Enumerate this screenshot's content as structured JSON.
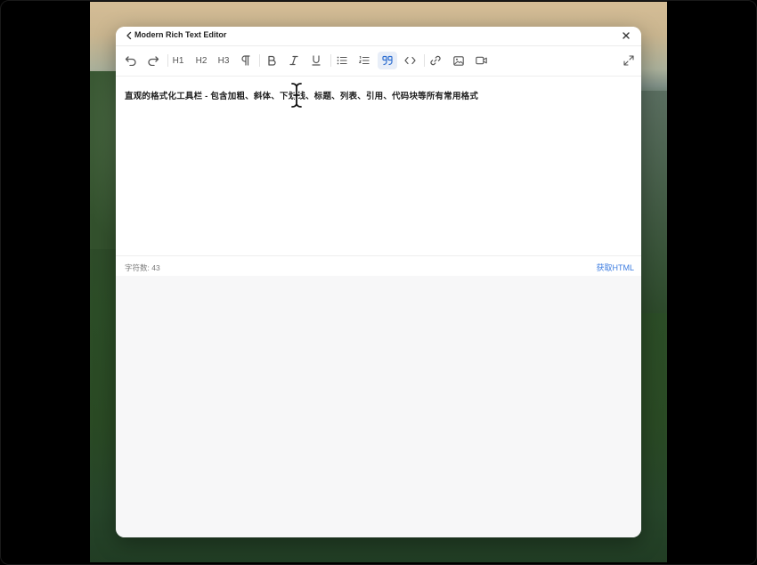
{
  "window": {
    "title": "Modern Rich Text Editor",
    "back_icon": "chevron-left-icon",
    "close_icon": "close-icon"
  },
  "toolbar": {
    "undo_icon": "undo-icon",
    "redo_icon": "redo-icon",
    "h1_label": "H1",
    "h2_label": "H2",
    "h3_label": "H3",
    "paragraph_icon": "paragraph-icon",
    "bold_icon": "bold-icon",
    "italic_icon": "italic-icon",
    "underline_icon": "underline-icon",
    "bullet_list_icon": "bullet-list-icon",
    "ordered_list_icon": "ordered-list-icon",
    "blockquote_icon": "quote-icon",
    "blockquote_active": true,
    "code_icon": "code-icon",
    "link_icon": "link-icon",
    "image_icon": "image-icon",
    "video_icon": "video-icon",
    "fullscreen_icon": "expand-icon",
    "accent_color": "#2f6fd1"
  },
  "editor": {
    "content": "直观的格式化工具栏 - 包含加粗、斜体、下划线、标题、列表、引用、代码块等所有常用格式"
  },
  "status": {
    "char_count_label": "字符数: 43",
    "get_html_label": "获取HTML",
    "link_color": "#3b7be0"
  }
}
